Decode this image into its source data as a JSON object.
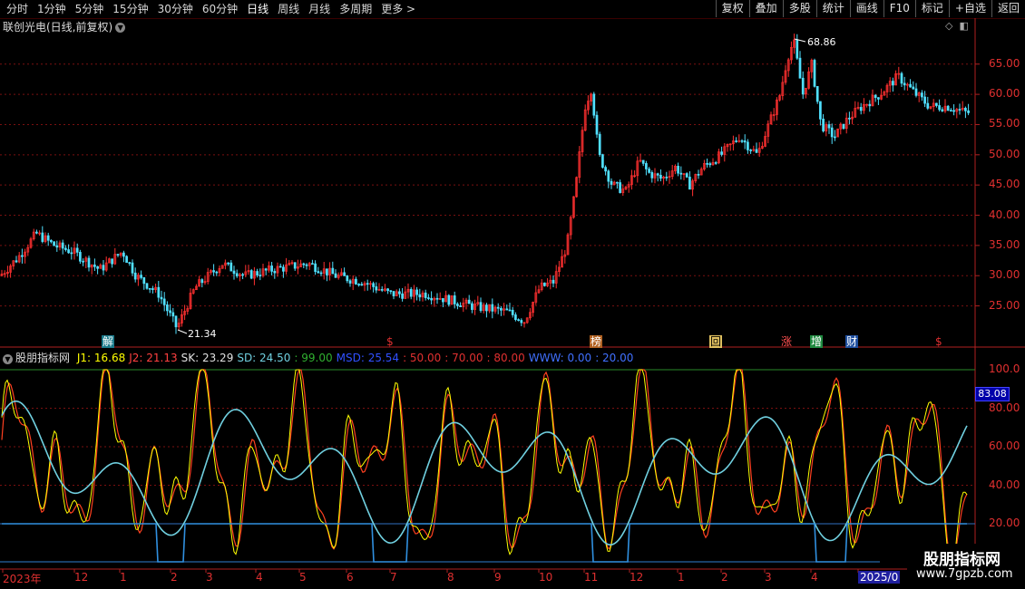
{
  "toolbar": {
    "periods": [
      "分时",
      "1分钟",
      "5分钟",
      "15分钟",
      "30分钟",
      "60分钟",
      "日线",
      "周线",
      "月线",
      "多周期",
      "更多 >"
    ],
    "active_period": "日线",
    "right_buttons": [
      "复权",
      "叠加",
      "多股",
      "统计",
      "画线",
      "F10",
      "标记",
      "+自选",
      "返回"
    ]
  },
  "main_chart": {
    "title": "联创光电(日线,前复权)",
    "high_label": "68.86",
    "low_label": "21.34",
    "y_ticks": [
      "65.00",
      "60.00",
      "55.00",
      "50.00",
      "45.00",
      "40.00",
      "35.00",
      "30.00",
      "25.00"
    ],
    "markers": [
      {
        "text": "解",
        "color": "#ffffff",
        "bg": "#1a7a8a"
      },
      {
        "text": "$",
        "color": "#e03030",
        "bg": ""
      },
      {
        "text": "榜",
        "color": "#ffffff",
        "bg": "#b06020"
      },
      {
        "text": "回",
        "color": "#000000",
        "bg": "#e0c060"
      },
      {
        "text": "涨",
        "color": "#ff5050",
        "bg": ""
      },
      {
        "text": "增",
        "color": "#ffffff",
        "bg": "#208a40"
      },
      {
        "text": "财",
        "color": "#ffffff",
        "bg": "#2050a0"
      },
      {
        "text": "$",
        "color": "#e03030",
        "bg": ""
      }
    ]
  },
  "indicator": {
    "name": "股朋指标网",
    "params": [
      {
        "label": "J1: ",
        "value": "16.68",
        "color": "#ffff00"
      },
      {
        "label": "J2: ",
        "value": "21.13",
        "color": "#ff4040"
      },
      {
        "label": "SK: ",
        "value": "23.29",
        "color": "#e0e0e0"
      },
      {
        "label": "SD: ",
        "value": "24.50",
        "color": "#70d0e0"
      },
      {
        "label": ": ",
        "value": "99.00",
        "color": "#30b030"
      },
      {
        "label": "MSD: ",
        "value": "25.54",
        "color": "#3050ff"
      },
      {
        "label": ": ",
        "value": "50.00",
        "color": "#e03030"
      },
      {
        "label": ": ",
        "value": "70.00",
        "color": "#e03030"
      },
      {
        "label": ": ",
        "value": "80.00",
        "color": "#e03030"
      },
      {
        "label": "WWW: ",
        "value": "0.00",
        "color": "#4070ff"
      },
      {
        "label": ": ",
        "value": "20.00",
        "color": "#4070ff"
      }
    ],
    "y_ticks": [
      "100.0",
      "80.00",
      "60.00",
      "40.00",
      "20.00"
    ],
    "current_value": "83.08"
  },
  "date_axis": [
    "2023年",
    "12",
    "1",
    "2",
    "3",
    "4",
    "5",
    "6",
    "7",
    "8",
    "9",
    "10",
    "11",
    "12",
    "1",
    "2",
    "3",
    "4",
    "2025/0"
  ],
  "watermark": {
    "line1": "股朋指标网",
    "line2": "www.7gpzb.com"
  }
}
